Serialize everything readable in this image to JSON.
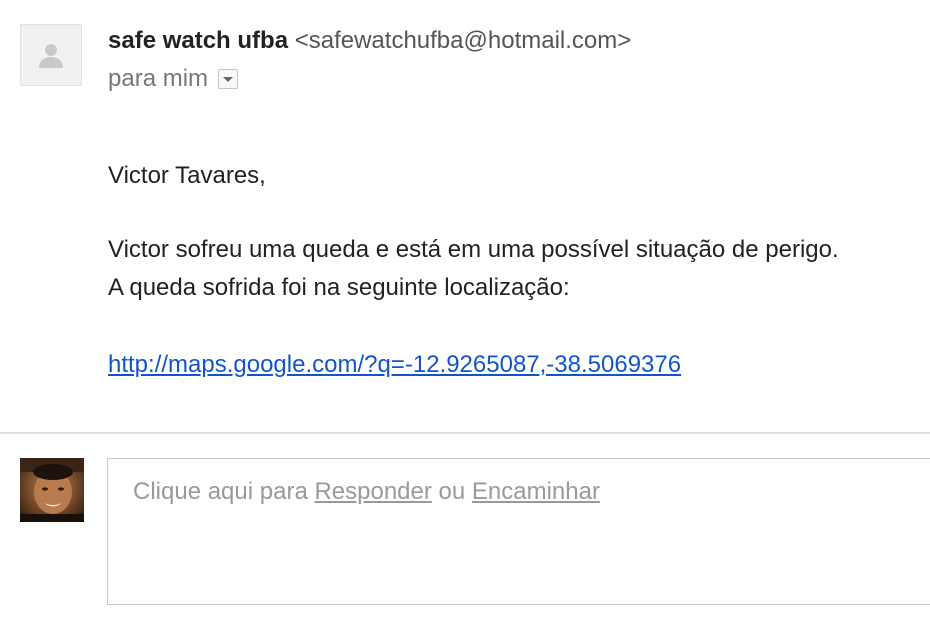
{
  "sender": {
    "name": "safe watch ufba",
    "email": "<safewatchufba@hotmail.com>",
    "recipient_label": "para mim",
    "avatar_icon": "person-placeholder-icon"
  },
  "message": {
    "greeting": "Victor Tavares,",
    "line1": "Victor sofreu uma queda e está em uma possível situação de perigo.",
    "line2": "A queda sofrida foi na seguinte localização:",
    "link": "http://maps.google.com/?q=-12.9265087,-38.5069376"
  },
  "reply": {
    "prefix": "Clique aqui para ",
    "reply_label": "Responder",
    "separator": " ou ",
    "forward_label": "Encaminhar"
  },
  "colors": {
    "link": "#1155cc",
    "muted": "#999999",
    "divider": "#e0e0e0"
  }
}
